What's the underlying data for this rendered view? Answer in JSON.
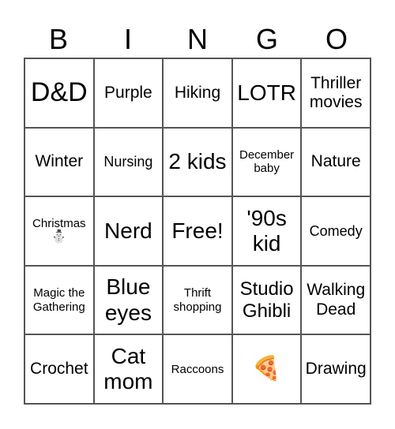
{
  "header": [
    "B",
    "I",
    "N",
    "G",
    "O"
  ],
  "cells": [
    {
      "text": "D&D",
      "size": "xl"
    },
    {
      "text": "Purple",
      "size": "s"
    },
    {
      "text": "Hiking",
      "size": "s"
    },
    {
      "text": "LOTR",
      "size": "l"
    },
    {
      "text": "Thriller movies",
      "size": "s"
    },
    {
      "text": "Winter",
      "size": "s"
    },
    {
      "text": "Nursing",
      "size": "xs"
    },
    {
      "text": "2 kids",
      "size": "l"
    },
    {
      "text": "December baby",
      "size": "xxs"
    },
    {
      "text": "Nature",
      "size": "s"
    },
    {
      "text": "Christmas",
      "size": "xxs",
      "emoji": "⛄"
    },
    {
      "text": "Nerd",
      "size": "l"
    },
    {
      "text": "Free!",
      "size": "l"
    },
    {
      "text": "'90s kid",
      "size": "l"
    },
    {
      "text": "Comedy",
      "size": "xs"
    },
    {
      "text": "Magic the Gathering",
      "size": "xxs"
    },
    {
      "text": "Blue eyes",
      "size": "l"
    },
    {
      "text": "Thrift shopping",
      "size": "xxs"
    },
    {
      "text": "Studio Ghibli",
      "size": "m"
    },
    {
      "text": "Walking Dead",
      "size": "s"
    },
    {
      "text": "Crochet",
      "size": "s"
    },
    {
      "text": "Cat mom",
      "size": "l"
    },
    {
      "text": "Raccoons",
      "size": "xxs"
    },
    {
      "text": "",
      "size": "emoji",
      "emoji": "🍕"
    },
    {
      "text": "Drawing",
      "size": "s"
    }
  ]
}
